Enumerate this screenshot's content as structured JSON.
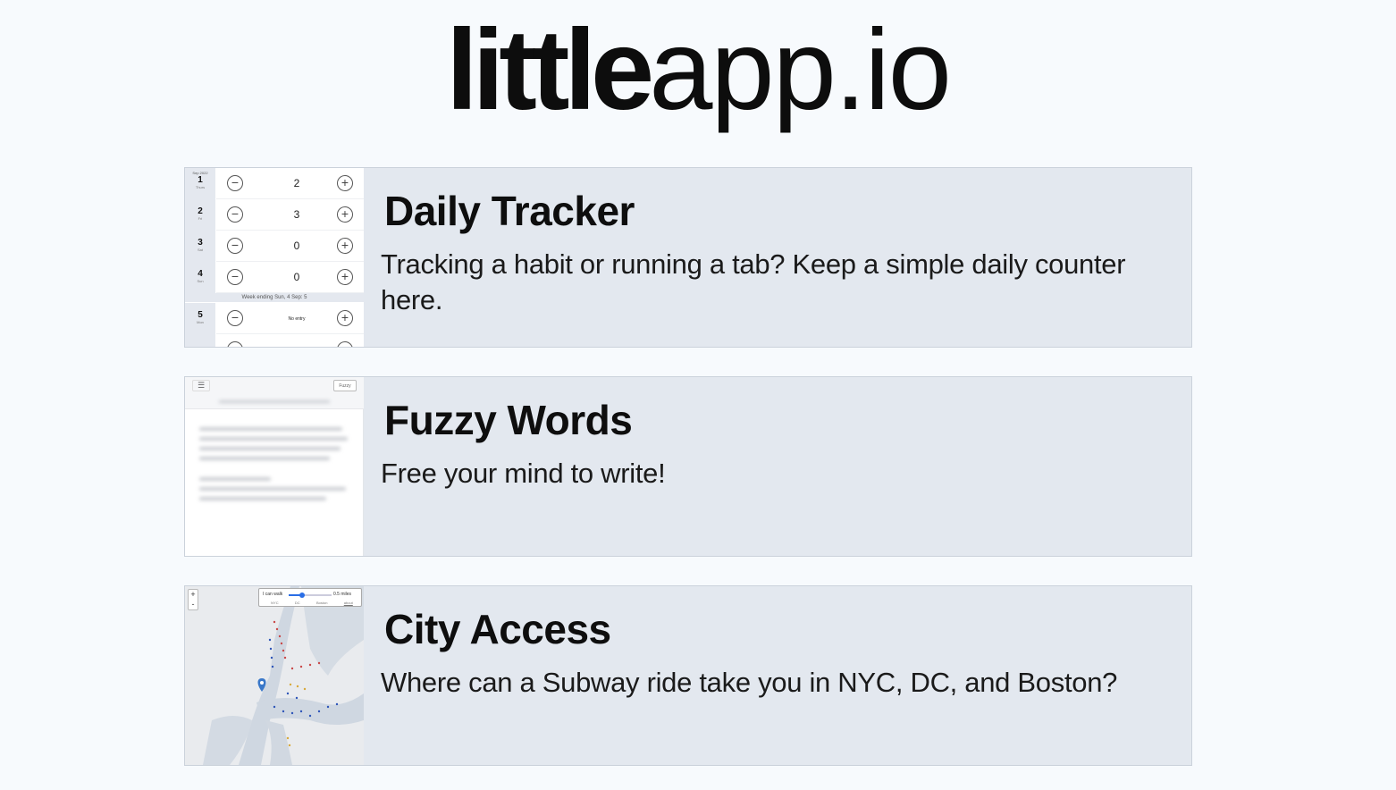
{
  "site": {
    "logo_bold": "little",
    "logo_light": "app.io"
  },
  "cards": [
    {
      "title": "Daily Tracker",
      "description": "Tracking a habit or running a tab? Keep a simple daily counter here."
    },
    {
      "title": "Fuzzy Words",
      "description": "Free your mind to write!"
    },
    {
      "title": "City Access",
      "description": "Where can a Subway ride take you in NYC, DC, and Boston?"
    }
  ],
  "daily_tracker_thumb": {
    "month_label": "Sep 2022",
    "rows": [
      {
        "day_num": "1",
        "day_name": "Thurs",
        "value": "2"
      },
      {
        "day_num": "2",
        "day_name": "Fri",
        "value": "3"
      },
      {
        "day_num": "3",
        "day_name": "Sat",
        "value": "0"
      },
      {
        "day_num": "4",
        "day_name": "Sun",
        "value": "0"
      }
    ],
    "week_label": "Week ending Sun, 4 Sep: 5",
    "row5": {
      "day_num": "5",
      "day_name": "Mon",
      "value": "No entry"
    },
    "minus_symbol": "−",
    "plus_symbol": "+"
  },
  "fuzzy_words_thumb": {
    "menu_symbol": "☰",
    "mode_button": "Fuzzy"
  },
  "city_access_thumb": {
    "zoom_in": "+",
    "zoom_out": "-",
    "walk_label": "I can walk",
    "distance": "0.5 miles",
    "cities": [
      "NYC",
      "DC",
      "Boston",
      "about"
    ]
  }
}
